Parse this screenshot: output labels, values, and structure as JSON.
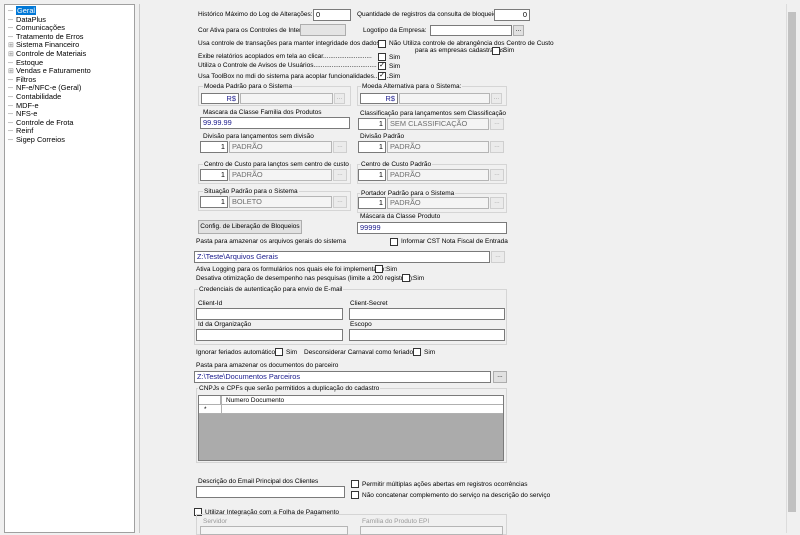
{
  "tree": {
    "items": [
      "Geral",
      "DataPlus",
      "Comunicações",
      "Tratamento de Erros",
      "Sistema Financeiro",
      "Controle de Materiais",
      "Estoque",
      "Vendas e Faturamento",
      "Filtros",
      "NF-e/NFC-e (Geral)",
      "Contabilidade",
      "MDF-e",
      "NFS-e",
      "Controle de Frota",
      "Reinf",
      "Sigep Correios"
    ]
  },
  "form": {
    "historico_label": "Histórico Máximo do Log de Alterações:",
    "historico_value": "0",
    "qtd_registros_label": "Quantidade de registros da consulta de bloqueio:",
    "qtd_registros_value": "0",
    "cor_ativa_label": "Cor Ativa para os Controles de Interface",
    "logotipo_label": "Logotipo da Empresa:",
    "usa_controle_label": "Usa controle de transações para manter integridade dos dados:",
    "nao_label": "Não",
    "abrangencia_label": "Utiliza controle de abrangência dos Centro de Custo",
    "abrangencia_label2": "para as empresas cadastradas:",
    "sim_label": "Sim",
    "exibe_label": "Exibe relatórios acoplados em tela ao clicar...........................",
    "avisos_label": "Utiliza o Controle de Avisos de Usuários...................................",
    "toolbox_label": "Usa ToolBox no mdi do sistema para acoplar funcionalidades.........",
    "check_mark": "✓",
    "moeda_padrao_label": "Moeda Padrão para o Sistema",
    "moeda_padrao_value": "R$",
    "moeda_alt_label": "Moeda Alternativa para o Sistema:",
    "moeda_alt_value": "R$",
    "mascara_label": "Mascara da Classe Familia dos Produtos",
    "mascara_value": "99.99.99",
    "classificacao_label": "Classificação para lançamentos sem Classificação",
    "classificacao_code": "1",
    "classificacao_value": "SEM CLASSIFICAÇÃO",
    "divisao_sem_label": "Divisão para lançamentos sem divisão",
    "divisao_sem_code": "1",
    "divisao_sem_value": "PADRÃO",
    "divisao_padrao_label": "Divisão Padrão",
    "divisao_padrao_code": "1",
    "divisao_padrao_value": "PADRÃO",
    "cc_sem_label": "Centro de Custo para lançtos sem centro de custo",
    "cc_sem_code": "1",
    "cc_sem_value": "PADRÃO",
    "cc_padrao_label": "Centro de Custo Padrão",
    "cc_padrao_code": "1",
    "cc_padrao_value": "PADRÃO",
    "situacao_label": "Situação Padrão para o Sistema",
    "situacao_code": "1",
    "situacao_value": "BOLETO",
    "portador_label": "Portador Padrão para o Sistema",
    "portador_code": "1",
    "portador_value": "PADRÃO",
    "config_btn": "Config. de Liberação de Bloqueios",
    "mascara_produto_label": "Máscara da Classe Produto",
    "mascara_produto_value": "99999",
    "pasta_label": "Pasta para amazenar os arquivos gerais do sistema",
    "informar_cst_label": "Informar CST Nota Fiscal de Entrada",
    "pasta_value": "Z:\\Teste\\Arquivos Gerais",
    "logging_label": "Ativa Logging para os formulários nos quais ele foi implementado:",
    "desativa_label": "Desativa otimização de desempenho nas pesquisas (limite a 200 registros):",
    "credenciais_label": "Credenciais de autenticação para envio de E-mail",
    "client_id_label": "Client-Id",
    "client_secret_label": "Client-Secret",
    "id_org_label": "Id da Organização",
    "escopo_label": "Escopo",
    "ignorar_feriados_label": "Ignorar feriados automáticos:",
    "desconsiderar_label": "Desconsiderar Carnaval como feriado:",
    "pasta_docs_label": "Pasta para amazenar os documentos do parceiro",
    "pasta_docs_value": "Z:\\Teste\\Documentos Parceiros",
    "cnpj_label": "CNPJs e CPFs que serão permitidos a duplicação do cadastro",
    "grid_col": "Numero Documento",
    "grid_row_marker": "*",
    "email_desc_label": "Descrição do Email Principal dos Clientes",
    "multiplas_label": "Permitir múltiplas ações abertas em registros ocorrências",
    "nao_concatenar_label": "Não concatenar complemento do serviço na descrição do serviço",
    "folha_label": "Utilizar Integração com a Folha de Pagamento",
    "servidor_label": "Servidor",
    "familia_label": "Família do Produto EPI",
    "ellipsis": "..."
  }
}
